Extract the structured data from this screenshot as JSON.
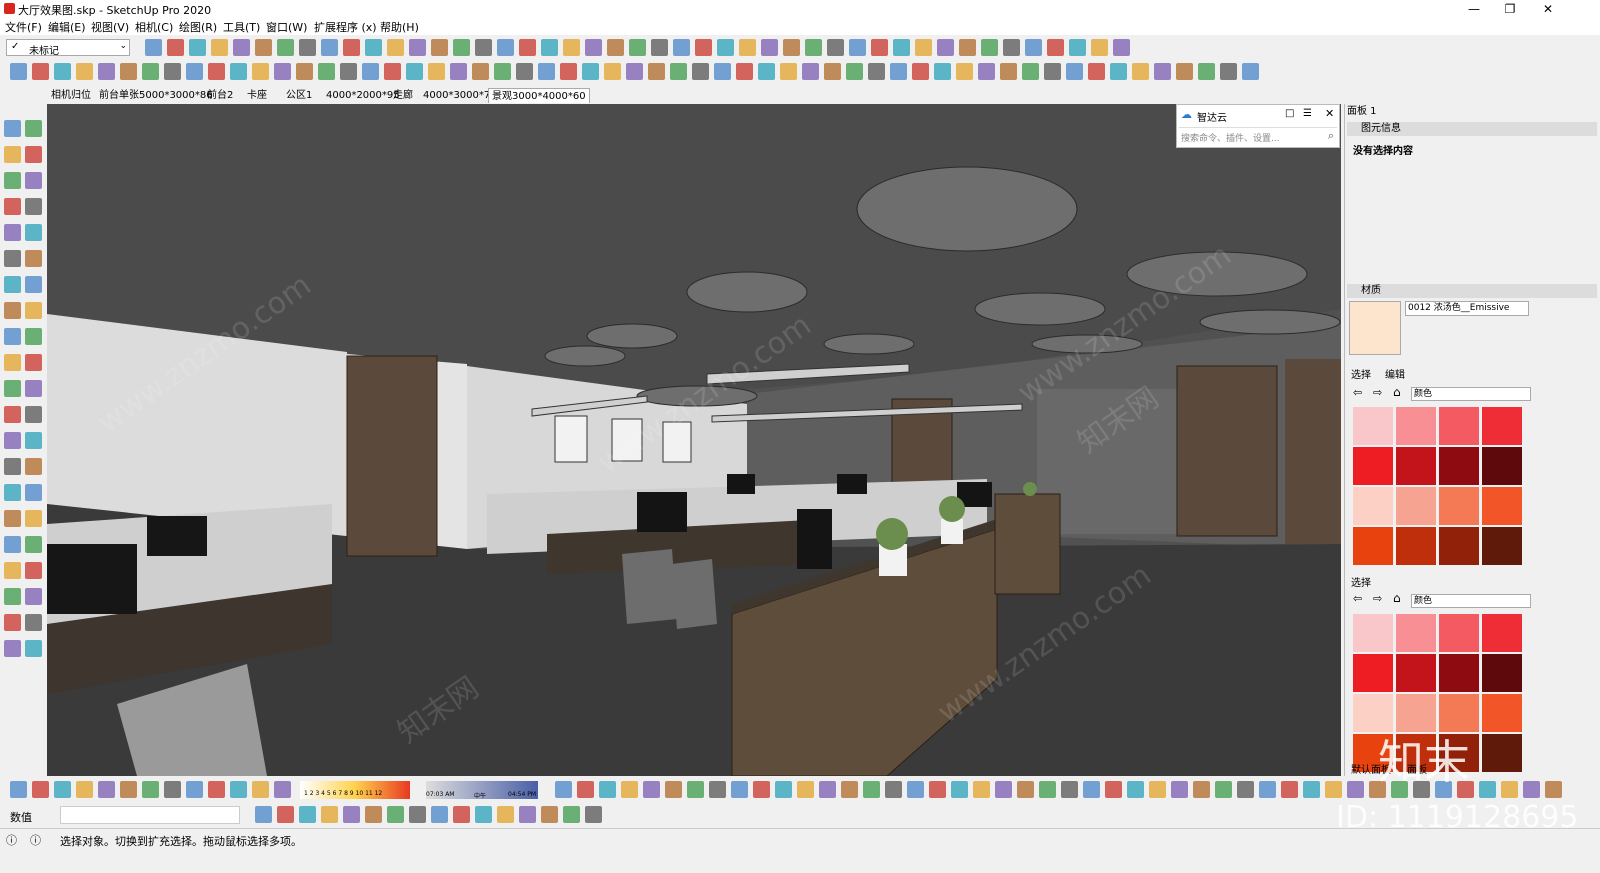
{
  "window": {
    "title": "大厅效果图.skp - SketchUp Pro 2020",
    "minimize": "—",
    "restore": "❐",
    "close": "✕"
  },
  "menu": [
    "文件(F)",
    "编辑(E)",
    "视图(V)",
    "相机(C)",
    "绘图(R)",
    "工具(T)",
    "窗口(W)",
    "扩展程序 (x)",
    "帮助(H)"
  ],
  "tag_dropdown": {
    "value": "未标记"
  },
  "scenes": [
    "相机归位",
    "前台单张5000*3000*86",
    "前台2",
    "卡座",
    "公区1",
    "4000*2000*95",
    "走廊",
    "4000*3000*70",
    "景观3000*4000*60"
  ],
  "active_scene_index": 8,
  "zhidayun": {
    "title": "智达云",
    "search_placeholder": "搜索命令、插件、设置..."
  },
  "panel": {
    "title": "面板 1",
    "entity_info": {
      "header": "图元信息",
      "text": "没有选择内容"
    },
    "materials": {
      "header": "材质",
      "material_name": "0012 浓汤色__Emissive",
      "tab_select": "选择",
      "tab_edit": "编辑",
      "dropdown": "颜色",
      "preview_color": "#fde4cc"
    },
    "select2": {
      "label": "选择",
      "dropdown": "颜色"
    },
    "bottom_tabs": [
      "默认面板",
      "面板"
    ]
  },
  "swatches": [
    "#f9c7c9",
    "#f78f94",
    "#f35a61",
    "#ee2d36",
    "#ee1d24",
    "#c3141b",
    "#8e0c11",
    "#5e0a0d",
    "#fcd0c5",
    "#f6a392",
    "#f47a56",
    "#f15528",
    "#e8430f",
    "#c02f0b",
    "#912109",
    "#5f1a0a"
  ],
  "shadow": {
    "months": "1 2 3 4 5 6 7 8 9 10 11 12",
    "time_start": "07:03 AM",
    "noon": "中午",
    "time_end": "04:54 PM"
  },
  "measurement": {
    "label": "数值",
    "value": ""
  },
  "status": {
    "text": "选择对象。切换到扩充选择。拖动鼠标选择多项。"
  },
  "watermark": {
    "brand": "知末",
    "id": "ID: 1119128695",
    "site": "www.znzmo.com",
    "site_cn": "知末网"
  }
}
